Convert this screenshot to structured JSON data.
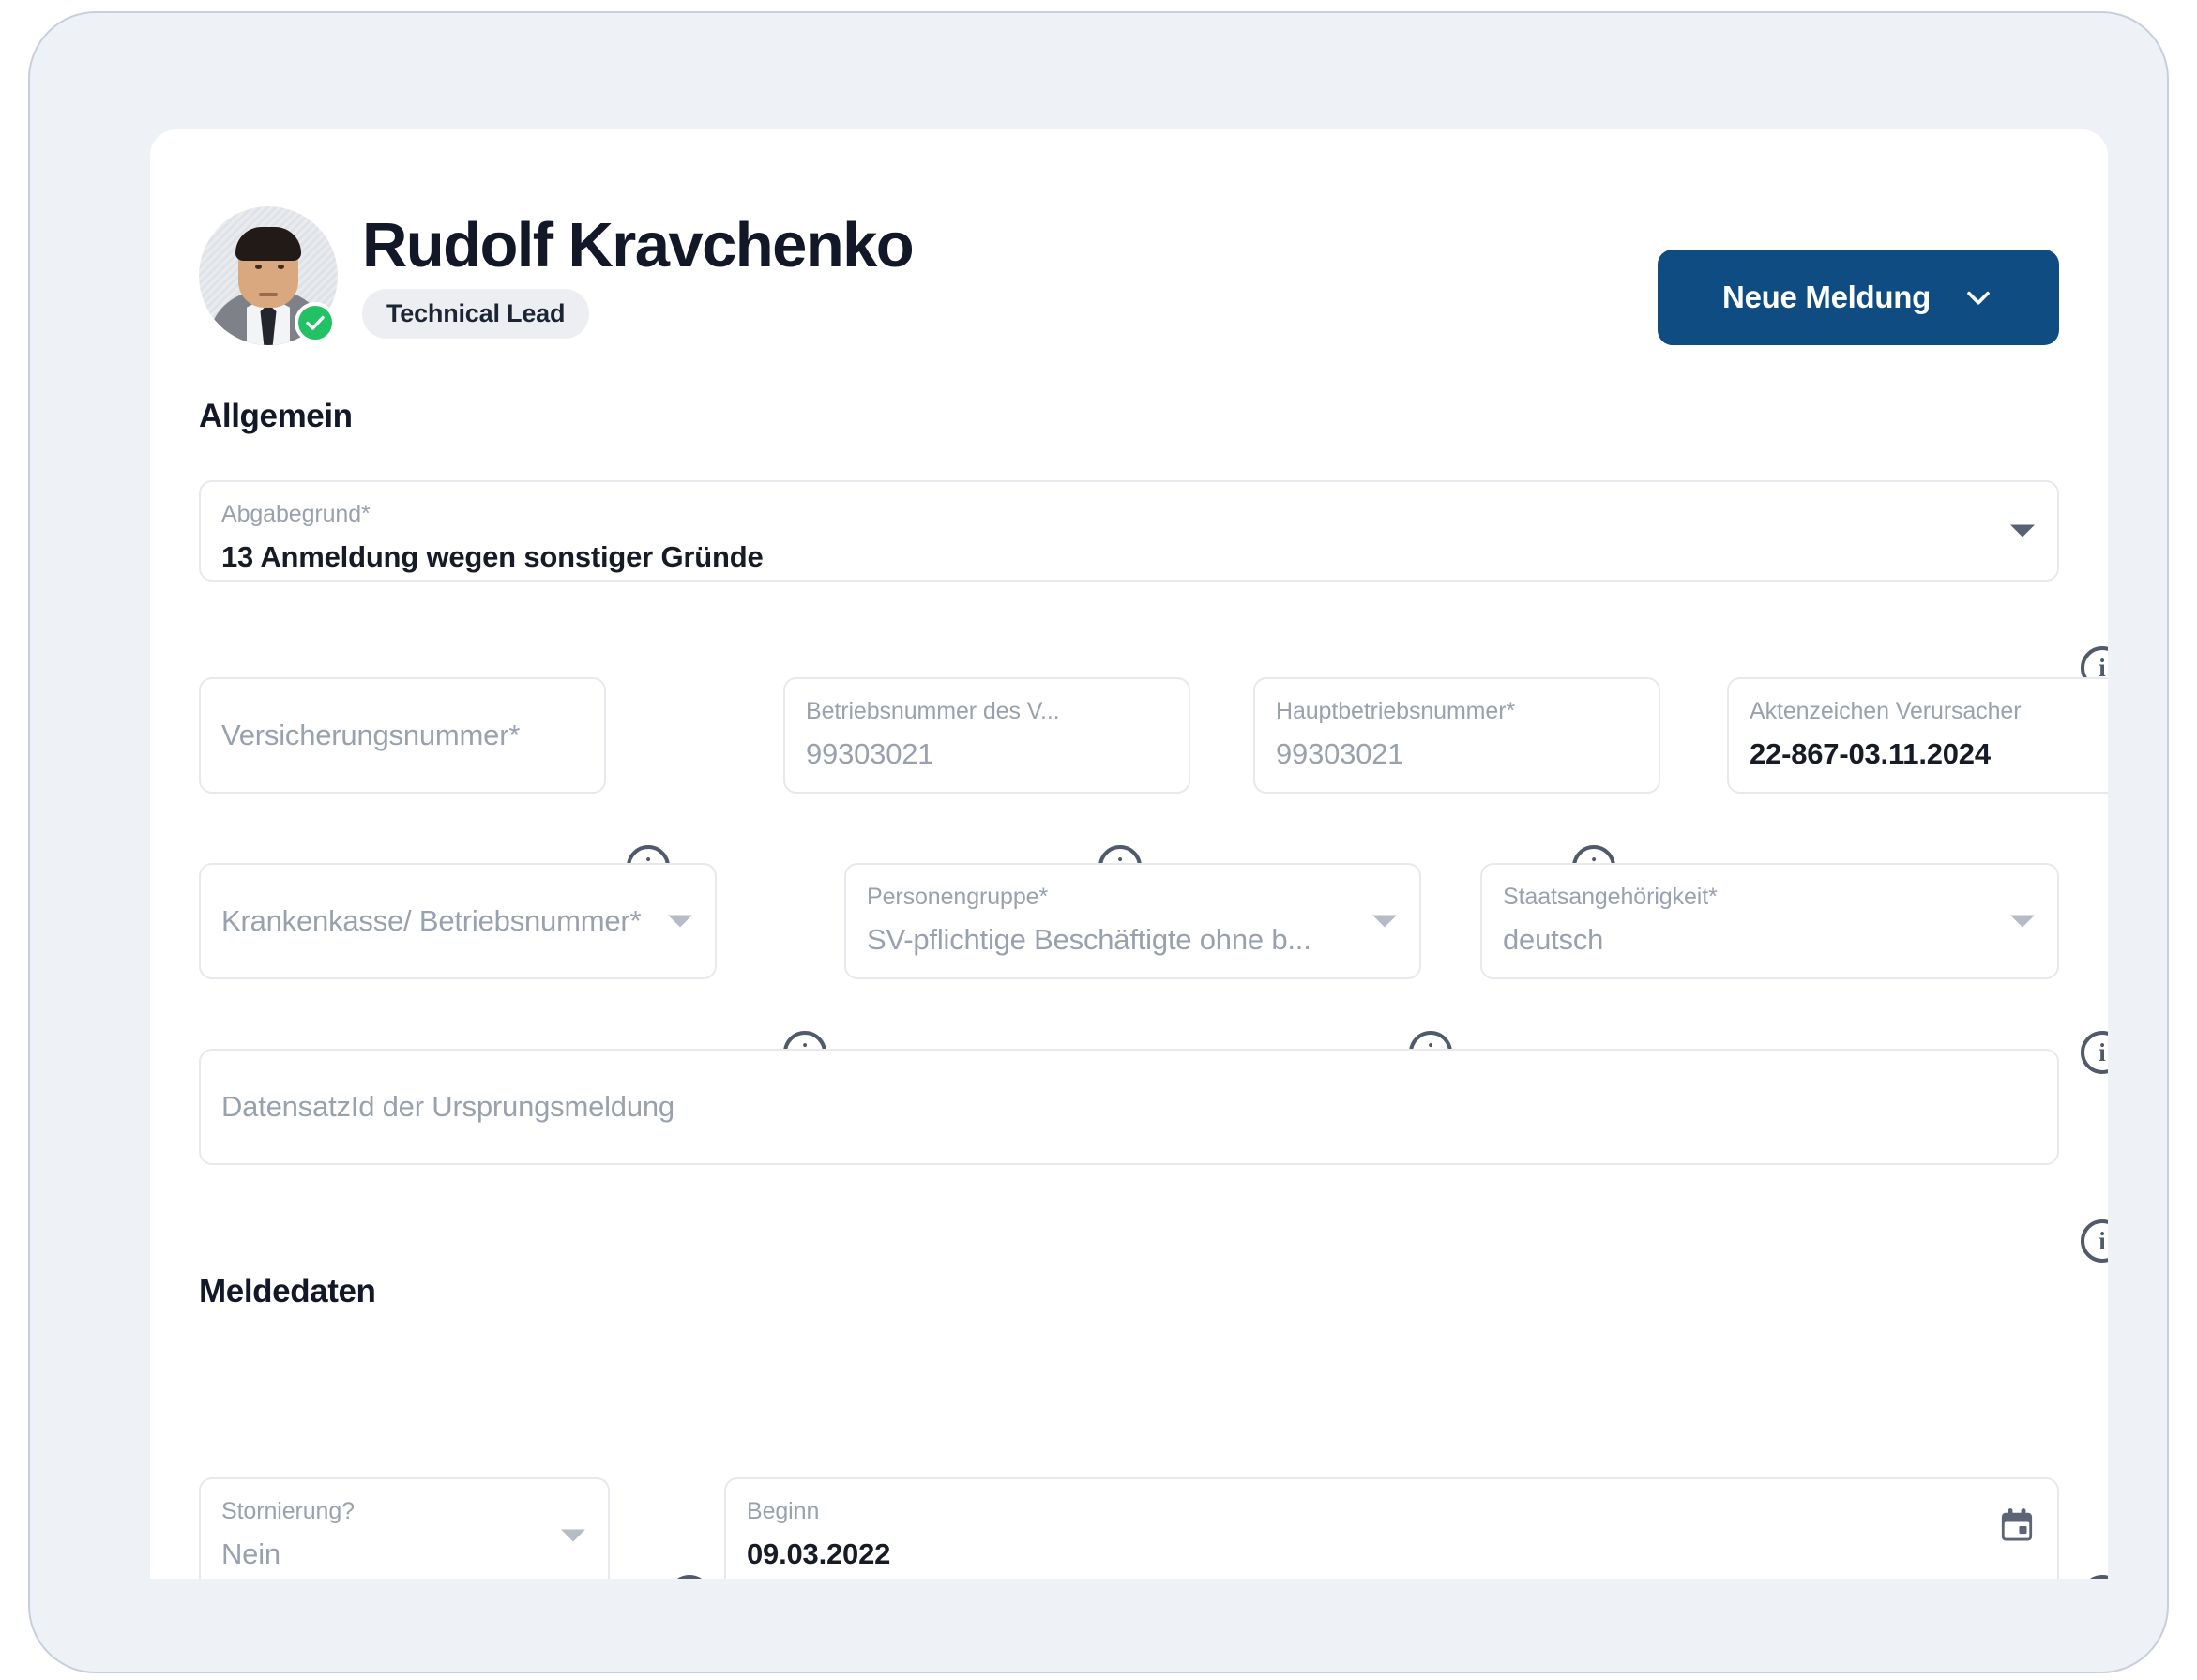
{
  "profile": {
    "name": "Rudolf Kravchenko",
    "role_badge": "Technical Lead",
    "avatar_name": "avatar",
    "verified": true
  },
  "toolbar": {
    "new_report_label": "Neue Meldung"
  },
  "sections": {
    "allgemein": "Allgemein",
    "meldedaten": "Meldedaten"
  },
  "fields": {
    "abgabegrund": {
      "label": "Abgabegrund*",
      "value": "13 Anmeldung wegen sonstiger Gründe"
    },
    "versicherungsnummer": {
      "placeholder": "Versicherungsnummer*"
    },
    "betriebsnummer_verursacher": {
      "label": "Betriebsnummer des V...",
      "value": "99303021"
    },
    "hauptbetriebsnummer": {
      "label": "Hauptbetriebsnummer*",
      "value": "99303021"
    },
    "aktenzeichen_verursacher": {
      "label": "Aktenzeichen Verursacher",
      "value": "22-867-03.11.2024"
    },
    "krankenkasse": {
      "placeholder": "Krankenkasse/ Betriebsnummer*"
    },
    "personengruppe": {
      "label": "Personengruppe*",
      "value": "SV-pflichtige Beschäftigte ohne b..."
    },
    "staatsangehoerigkeit": {
      "label": "Staatsangehörigkeit*",
      "value": "deutsch"
    },
    "datensatz_id": {
      "placeholder": "DatensatzId der Ursprungsmeldung"
    },
    "stornierung": {
      "label": "Stornierung?",
      "value": "Nein"
    },
    "beginn": {
      "label": "Beginn",
      "value": "09.03.2022"
    }
  },
  "colors": {
    "accent": "#0f4c81",
    "verified_green": "#22c264",
    "frame_bg": "#eef1f6",
    "text_dark": "#121828",
    "text_muted": "#9aa1ae"
  }
}
